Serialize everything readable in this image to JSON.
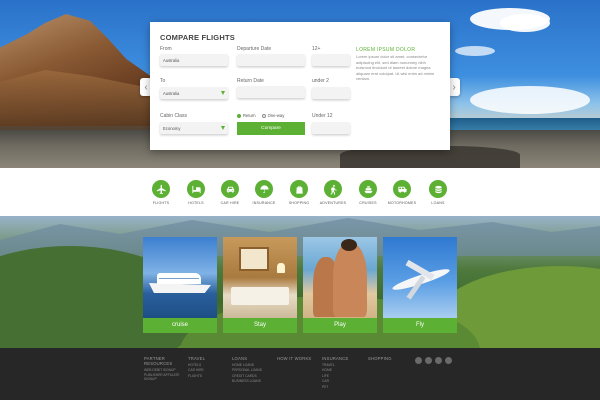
{
  "hero": {
    "prev_arrow": "‹",
    "next_arrow": "›"
  },
  "form": {
    "title": "COMPARE FLIGHTS",
    "from_label": "From",
    "from_value": "Australia",
    "to_label": "To",
    "to_value": "Australia",
    "cabin_label": "Cabin Class",
    "cabin_value": "Economy",
    "departure_label": "Departure Date",
    "return_label": "Return Date",
    "age12plus_label": "12+",
    "under2_label": "under 2",
    "under12_label": "Under 12",
    "radio_return": "Return",
    "radio_oneway": "One-way",
    "compare_label": "Compare",
    "lorem_title": "LOREM IPSUM DOLOR",
    "lorem_body": "Lorem ipsum dolor sit amet, consectetur adipiscing elit, sed diam nonummy nibh euismod tincidunt ut laoreet dolore magna aliquam erat volutpat. Ut wisi enim ad minim veniam."
  },
  "categories": [
    {
      "label": "FLIGHTS",
      "icon": "plane-icon"
    },
    {
      "label": "HOTELS",
      "icon": "hotel-icon"
    },
    {
      "label": "CAR HIRE",
      "icon": "car-icon"
    },
    {
      "label": "INSURANCE",
      "icon": "umbrella-icon"
    },
    {
      "label": "SHOPPING",
      "icon": "shopping-bag-icon"
    },
    {
      "label": "ADVENTURES",
      "icon": "hiker-icon"
    },
    {
      "label": "CRUISES",
      "icon": "ship-icon"
    },
    {
      "label": "MOTORHOMES",
      "icon": "motorhome-icon"
    },
    {
      "label": "LOANS",
      "icon": "coins-icon"
    }
  ],
  "tiles": [
    {
      "label": "cruise"
    },
    {
      "label": "Stay"
    },
    {
      "label": "Play"
    },
    {
      "label": "Fly"
    }
  ],
  "footer": {
    "columns": [
      {
        "heading": "PARTNER RESOURCES",
        "items": [
          "WEB DEBIT SIGNUP",
          "PUBLISHER AFFILIATE SIGNUP"
        ]
      },
      {
        "heading": "TRAVEL",
        "items": [
          "HOTELS",
          "CAR HIRE",
          "FLIGHTS"
        ]
      },
      {
        "heading": "LOANS",
        "items": [
          "HOME LOANS",
          "PERSONAL LOANS",
          "CREDIT CARDS",
          "BUSINESS LOANS"
        ]
      },
      {
        "heading": "HOW IT WORKS",
        "items": []
      },
      {
        "heading": "INSURANCE",
        "items": [
          "TRAVEL",
          "HOME",
          "LIFE",
          "CAR",
          "PET"
        ]
      },
      {
        "heading": "SHOPPING",
        "items": []
      }
    ],
    "social": [
      "facebook-icon",
      "twitter-icon",
      "google-plus-icon",
      "linkedin-icon"
    ]
  },
  "colors": {
    "accent": "#5cb034",
    "footer_bg": "#272727"
  }
}
